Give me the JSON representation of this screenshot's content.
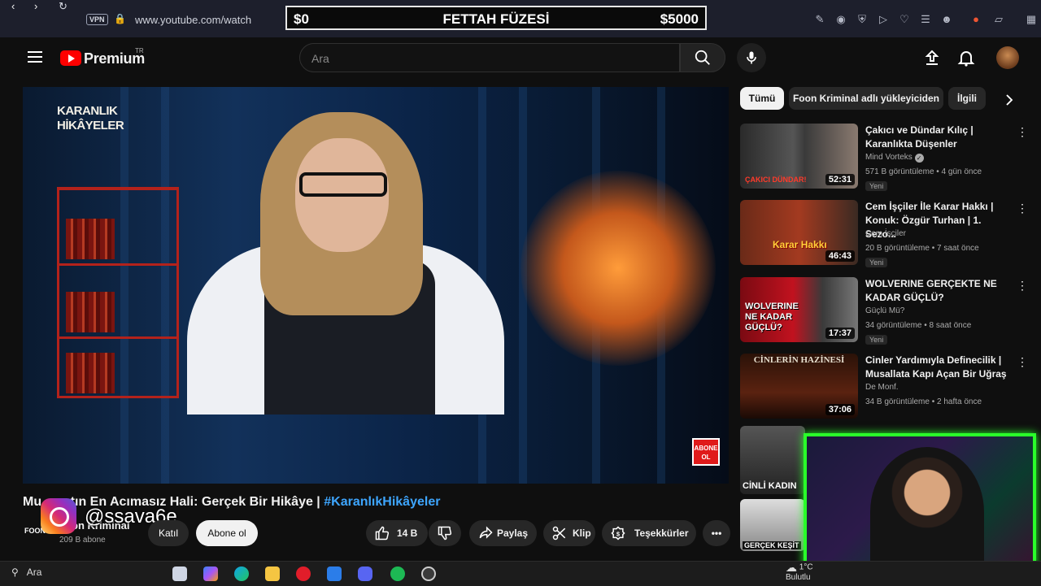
{
  "browser": {
    "vpn_label": "VPN",
    "url": "www.youtube.com/watch"
  },
  "donation_goal": {
    "start": "$0",
    "title": "FETTAH FÜZESİ",
    "target": "$5000"
  },
  "header": {
    "brand": "Premium",
    "country": "TR",
    "search_placeholder": "Ara"
  },
  "player": {
    "overlay_channel": "KARANLIK\nHİKÂYELER",
    "subscribe_badge": "ABONE OL"
  },
  "video": {
    "title_visible": "Mu        tın En Acımasız Hali: Gerçek Bir Hikâye | ",
    "title_tag": "#KaranlıkHikâyeler",
    "channel_name": "on Kriminal",
    "channel_avatar_text": "FOON",
    "subscribers": "209 B abone",
    "join_label": "Katıl",
    "subscribe_label": "Abone ol",
    "likes": "14 B",
    "share_label": "Paylaş",
    "clip_label": "Klip",
    "thanks_label": "Teşekkürler"
  },
  "instagram": {
    "handle": "@ssava6e"
  },
  "chips": {
    "all": "Tümü",
    "channel": "Foon Kriminal adlı yükleyiciden",
    "related": "İlgili"
  },
  "recommendations": [
    {
      "title": "Çakıcı ve Dündar Kılıç | Karanlıkta Düşenler",
      "channel": "Mind Vorteks",
      "meta": "571 B görüntüleme • 4 gün önce",
      "badge": "Yeni",
      "duration": "52:31",
      "thumb_text": "ÇAKICI   DÜNDAR!"
    },
    {
      "title": "Cem İşçiler İle Karar Hakkı | Konuk: Özgür Turhan | 1. Sezo...",
      "channel": "Cem İşçiler",
      "meta": "20 B görüntüleme • 7 saat önce",
      "badge": "Yeni",
      "duration": "46:43",
      "thumb_text": "Karar Hakkı"
    },
    {
      "title": "WOLVERINE GERÇEKTE NE KADAR GÜÇLÜ?",
      "channel": "Güçlü Mü?",
      "meta": "34 görüntüleme • 8 saat önce",
      "badge": "Yeni",
      "duration": "17:37",
      "thumb_text": "WOLVERINE NE KADAR GÜÇLÜ?"
    },
    {
      "title": "Cinler Yardımıyla Definecilik | Musallata Kapı Açan Bir Uğraş",
      "channel": "De Monf.",
      "meta": "34 B görüntüleme • 2 hafta önce",
      "badge": "",
      "duration": "37:06",
      "thumb_text": "CİNLERİN HAZİNESİ"
    }
  ],
  "partial_thumbs": [
    {
      "text": "CİNLİ KADIN"
    },
    {
      "text": "GERÇEK KEŞİT"
    }
  ],
  "taskbar": {
    "search_label": "Ara",
    "weather_temp": "1°C",
    "weather_desc": "Bulutlu"
  },
  "colors": {
    "youtube_red": "#ff0000",
    "link_blue": "#3ea6ff",
    "webcam_border": "#2aff2a"
  }
}
